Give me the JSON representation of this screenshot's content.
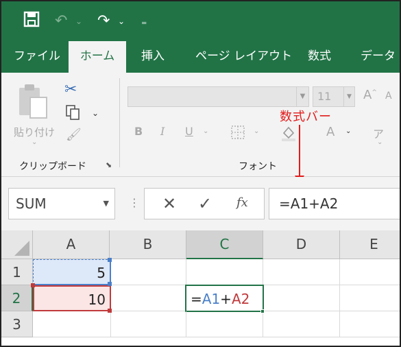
{
  "quick_access": {
    "save_icon": "save-icon",
    "undo_icon": "undo-icon",
    "redo_icon": "redo-icon",
    "customize_icon": "customize-qat-icon"
  },
  "tabs": [
    {
      "label": "ファイル"
    },
    {
      "label": "ホーム"
    },
    {
      "label": "挿入"
    },
    {
      "label": "ページ レイアウト"
    },
    {
      "label": "数式"
    },
    {
      "label": "データ"
    }
  ],
  "ribbon": {
    "clipboard": {
      "paste_label": "貼り付け",
      "group_label": "クリップボード"
    },
    "font": {
      "font_name": "",
      "font_size": "11",
      "group_label": "フォント",
      "bold": "B",
      "italic": "I",
      "underline": "U",
      "font_color_letter": "A",
      "phonetic_letter": "ア"
    }
  },
  "annotation": {
    "label": "数式バー",
    "color": "#e21b1b"
  },
  "formula_bar": {
    "name_box": "SUM",
    "fx": "fx",
    "formula": "=A1+A2"
  },
  "sheet": {
    "columns": [
      "A",
      "B",
      "C",
      "D",
      "E"
    ],
    "rows": [
      "1",
      "2",
      "3"
    ],
    "cells": {
      "A1": "5",
      "A2": "10",
      "C2": {
        "eq": "=",
        "ref1": "A1",
        "plus": "+",
        "ref2": "A2"
      }
    },
    "colors": {
      "accent": "#217346",
      "ref1": "#4a7fc9",
      "ref2": "#c0393b"
    }
  }
}
